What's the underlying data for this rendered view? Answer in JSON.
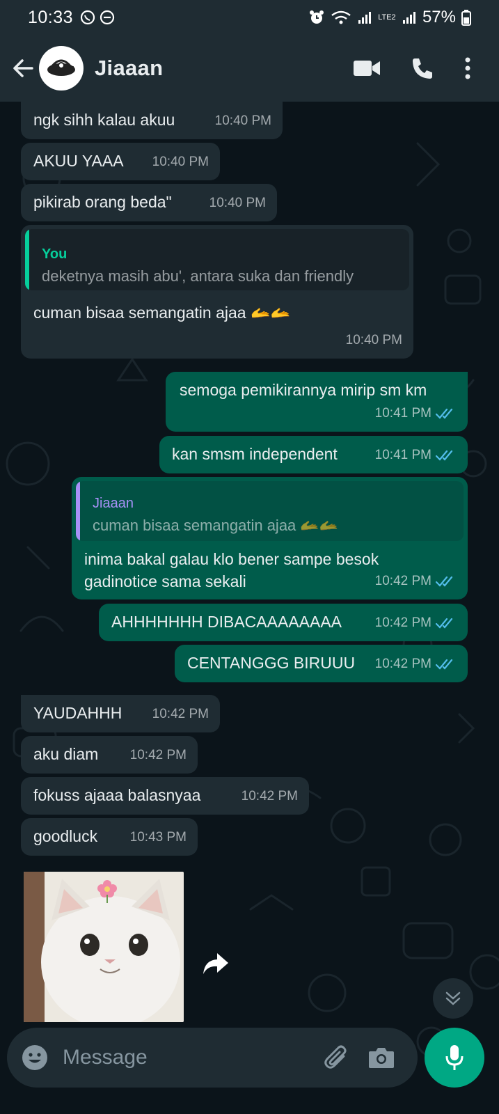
{
  "status_bar": {
    "time": "10:33",
    "lte_label": "LTE2",
    "battery": "57%"
  },
  "header": {
    "contact_name": "Jiaaan",
    "icons": [
      "back-arrow-icon",
      "video-call-icon",
      "phone-icon",
      "more-options-icon"
    ]
  },
  "messages": [
    {
      "dir": "in",
      "text": "ngk sihh kalau akuu",
      "time": "10:40 PM"
    },
    {
      "dir": "in",
      "text": "AKUU YAAA",
      "time": "10:40 PM"
    },
    {
      "dir": "in",
      "text": "pikirab orang beda\"",
      "time": "10:40 PM"
    },
    {
      "dir": "in",
      "quote_author": "You",
      "quote_text": "deketnya masih abu', antara suka dan friendly",
      "text": "cuman bisaa semangatin ajaa 🫴🫴",
      "time": "10:40 PM"
    },
    {
      "dir": "out",
      "text": "semoga pemikirannya mirip sm km",
      "time": "10:41 PM"
    },
    {
      "dir": "out",
      "text": "kan smsm independent",
      "time": "10:41 PM"
    },
    {
      "dir": "out",
      "quote_author": "Jiaaan",
      "quote_text": "cuman bisaa semangatin ajaa 🫴🫴",
      "text_line1": "inima bakal galau klo bener sampe besok",
      "text_line2": "gadinotice sama sekali",
      "time": "10:42 PM"
    },
    {
      "dir": "out",
      "text": "AHHHHHHH DIBACAAAAAAAA",
      "time": "10:42 PM"
    },
    {
      "dir": "out",
      "text": "CENTANGGG BIRUUU",
      "time": "10:42 PM"
    },
    {
      "dir": "in",
      "text": "YAUDAHHH",
      "time": "10:42 PM"
    },
    {
      "dir": "in",
      "text": "aku diam",
      "time": "10:42 PM"
    },
    {
      "dir": "in",
      "text": "fokuss ajaaa balasnyaa",
      "time": "10:42 PM"
    },
    {
      "dir": "in",
      "text": "goodluck",
      "time": "10:43 PM"
    }
  ],
  "sticker": {
    "description_icon": "cat-sticker"
  },
  "composer": {
    "placeholder": "Message",
    "icons": [
      "emoji-icon",
      "attach-icon",
      "camera-icon",
      "mic-icon"
    ]
  },
  "colors": {
    "incoming_bubble": "#1f2c33",
    "outgoing_bubble": "#005c4b",
    "quote_you": "#06cf9c",
    "quote_contact": "#a791f7",
    "read_ticks": "#53bdeb",
    "accent": "#00a884"
  }
}
